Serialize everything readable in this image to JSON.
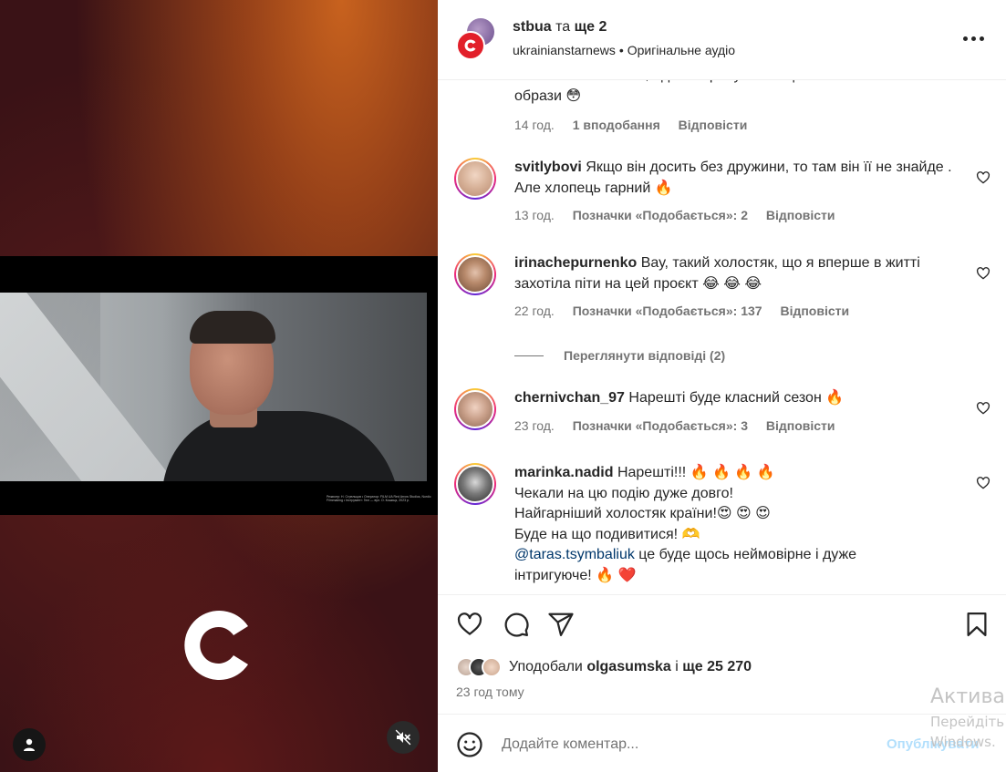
{
  "header": {
    "username": "stbua",
    "and_label": "та",
    "more_label": "ще 2",
    "subtitle_user": "ukrainianstarnews",
    "subtitle_sep": "•",
    "audio_label": "Оригінальне аудіо"
  },
  "comments": [
    {
      "id": "partial",
      "username": "",
      "text": "или на телебаченні, йдьт і спробуйте як це а потім пишіть образи 😳",
      "time": "14 год.",
      "likes": "1 вподобання",
      "reply": "Відповісти"
    },
    {
      "id": "c1",
      "username": "svitlybovi",
      "text": "Якщо він досить без дружини, то там він її не знайде . Але хлопець гарний 🔥",
      "time": "13 год.",
      "likes": "Позначки «Подобається»: 2",
      "reply": "Відповісти"
    },
    {
      "id": "c2",
      "username": "irinachepurnenko",
      "text": "Вау, такий холостяк, що я вперше в житті захотіла піти на цей проєкт 😂 😂 😂",
      "time": "22 год.",
      "likes": "Позначки «Подобається»: 137",
      "reply": "Відповісти"
    },
    {
      "id": "c3",
      "username": "chernivchan_97",
      "text": "Нарешті буде класний сезон 🔥",
      "time": "23 год.",
      "likes": "Позначки «Подобається»: 3",
      "reply": "Відповісти"
    },
    {
      "id": "c4",
      "username": "marinka.nadid",
      "lines": [
        "Нарешті!!! 🔥 🔥 🔥 🔥",
        "Чекали на цю подію дуже довго!",
        "Найгарніший холостяк країни!😍 😍 😍",
        "Буде на що подивитися! 🫶"
      ],
      "mention": "@taras.tsymbaliuk",
      "mention_rest": " це буде щось неймовірне і дуже",
      "last_line": "інтригуюче! 🔥 ❤️"
    }
  ],
  "view_replies": "Переглянути відповіді (2)",
  "likes": {
    "label": "Уподобали",
    "user": "olgasumska",
    "and": "і",
    "count": "ще 25 270"
  },
  "post_time": "23 год тому",
  "composer": {
    "placeholder": "Додайте коментар...",
    "publish": "Опублікувати"
  },
  "video": {
    "credits": "Режисер: Н. Стрельцов • Оператор: FILM UA Red Arrow Studios, Nordic Filmmaking • Інструмент: Гелі — вул. О. Кошиця, 2023 р."
  },
  "watermark": {
    "line1": "Актива",
    "line2": "Перейдіть",
    "line3": "Windows."
  },
  "colors": {
    "brand_red": "#e21f2a",
    "link": "#00376b",
    "muted": "#737373"
  }
}
